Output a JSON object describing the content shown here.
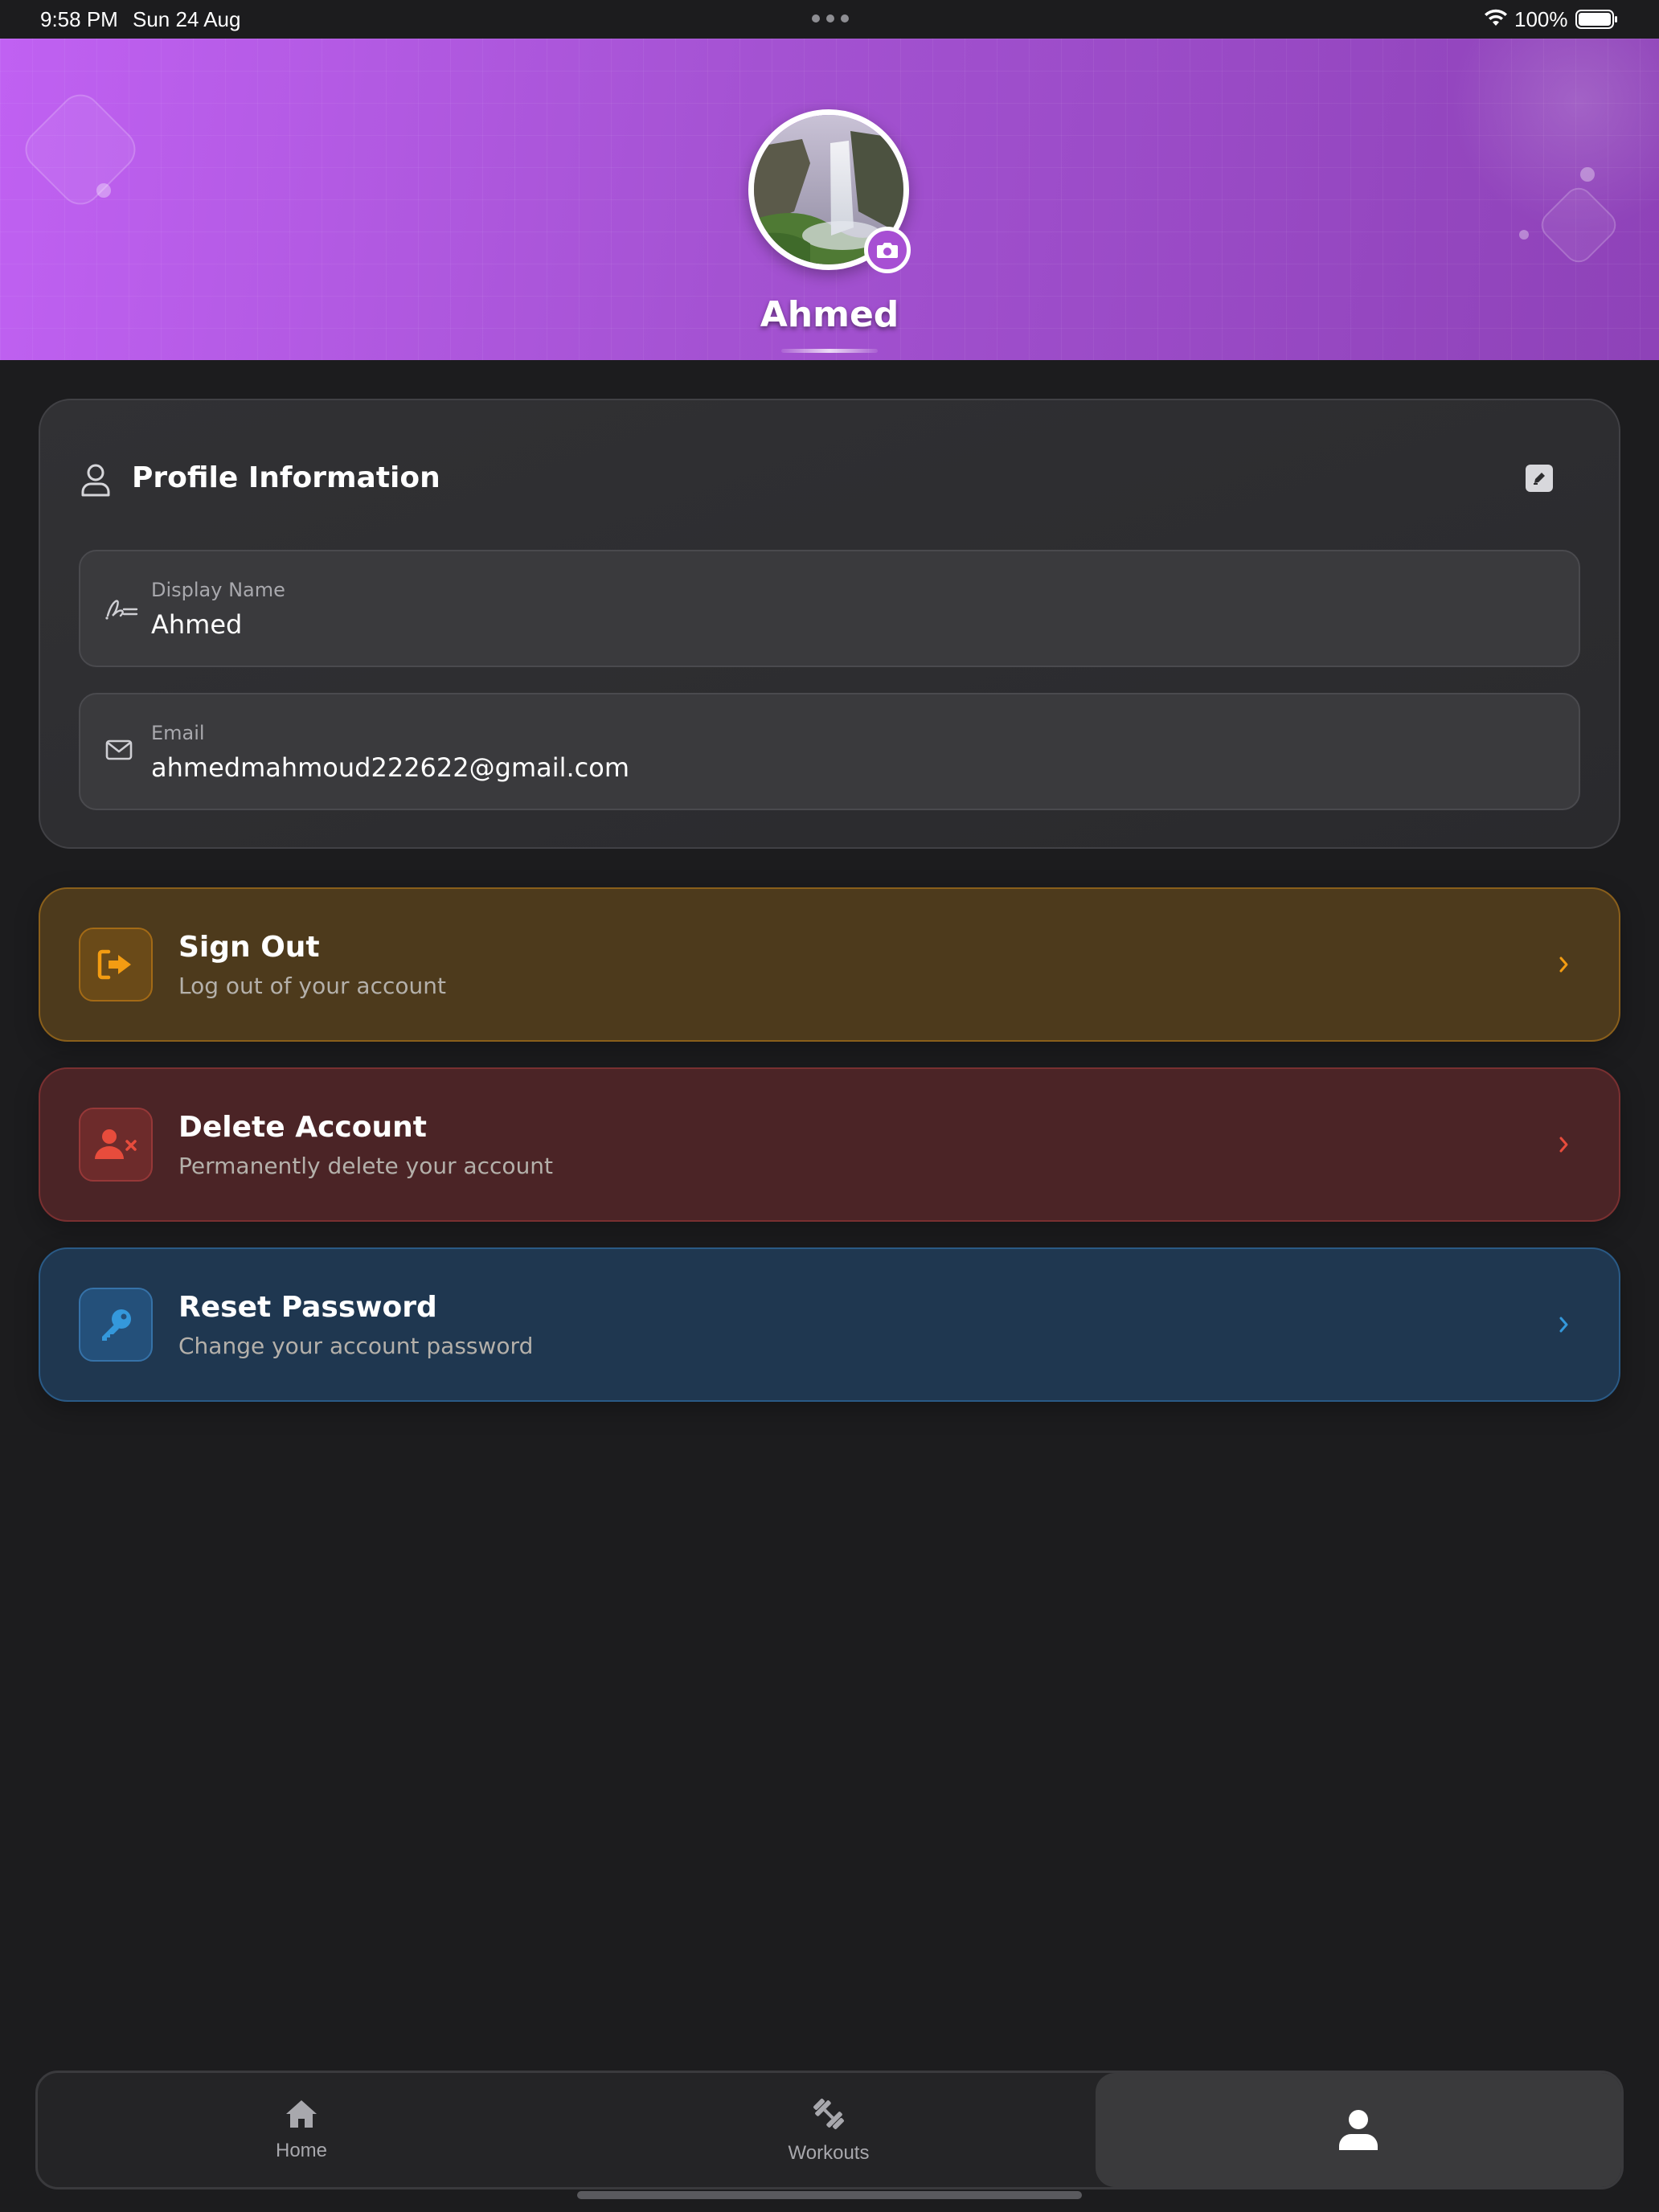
{
  "status_bar": {
    "time": "9:58 PM",
    "date": "Sun 24 Aug",
    "battery": "100%"
  },
  "header": {
    "name": "Ahmed",
    "gradient_start": "#c061f2",
    "gradient_end": "#8e42b8"
  },
  "profile_card": {
    "title": "Profile Information",
    "fields": [
      {
        "label": "Display Name",
        "value": "Ahmed",
        "icon": "signature-icon"
      },
      {
        "label": "Email",
        "value": "ahmedmahmoud222622@gmail.com",
        "icon": "mail-icon"
      }
    ]
  },
  "actions": [
    {
      "title": "Sign Out",
      "subtitle": "Log out of your account",
      "icon": "sign-out-icon",
      "accent": "#f39c12"
    },
    {
      "title": "Delete Account",
      "subtitle": "Permanently delete your account",
      "icon": "user-delete-icon",
      "accent": "#e74c3c"
    },
    {
      "title": "Reset Password",
      "subtitle": "Change your account password",
      "icon": "key-icon",
      "accent": "#3498db"
    }
  ],
  "bottom_nav": {
    "items": [
      {
        "label": "Home",
        "icon": "home-icon"
      },
      {
        "label": "Workouts",
        "icon": "dumbbell-icon"
      },
      {
        "label": "",
        "icon": "person-icon",
        "active": true
      }
    ]
  }
}
